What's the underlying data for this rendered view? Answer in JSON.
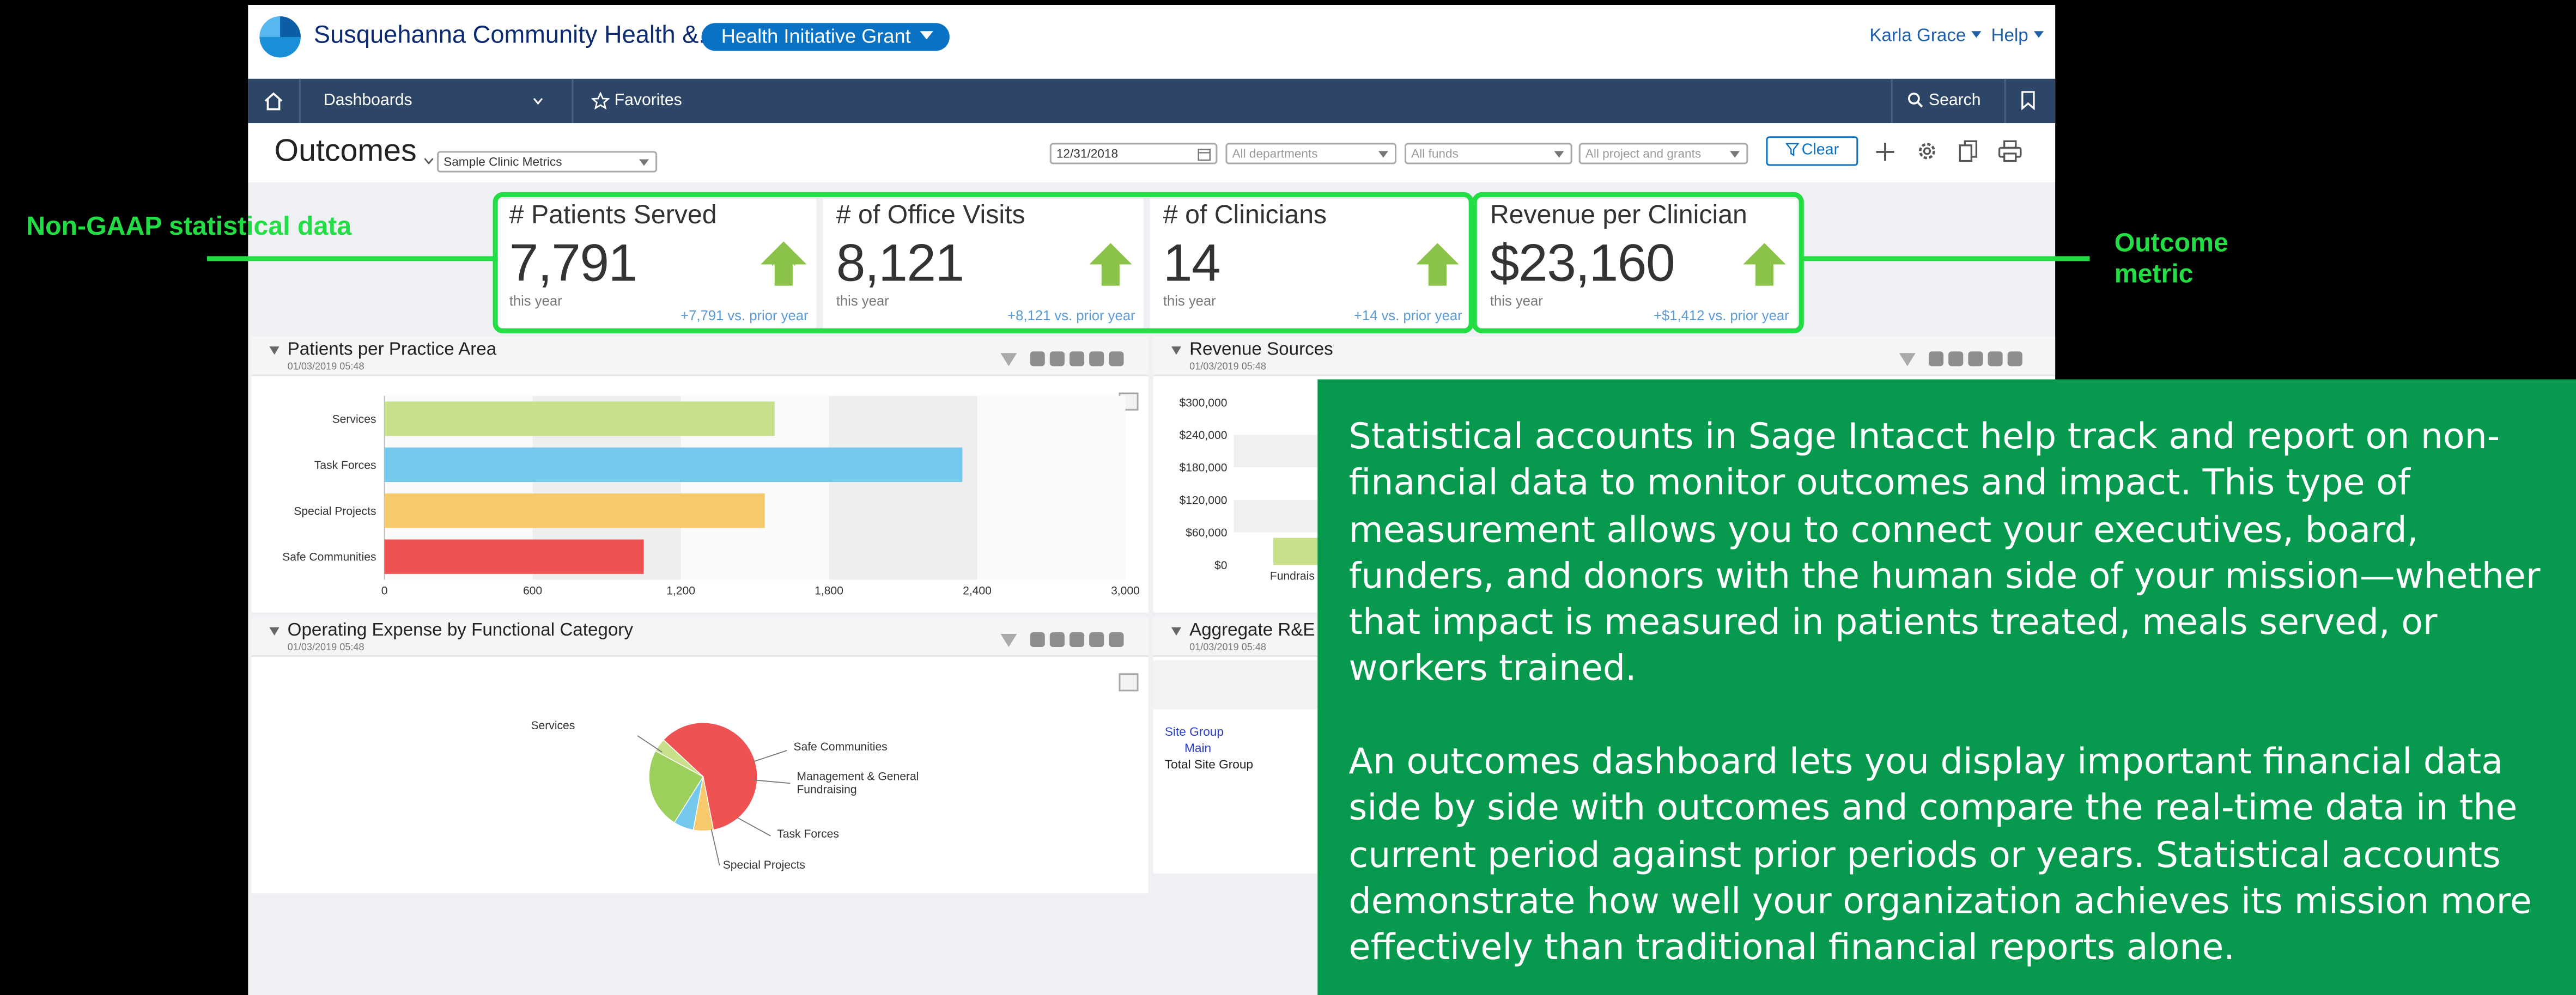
{
  "app": {
    "company": "Susquehanna Community Health &...",
    "grant_button": "Health Initiative Grant",
    "user": "Karla Grace",
    "help": "Help"
  },
  "navbar": {
    "dashboards": "Dashboards",
    "favorites": "Favorites",
    "search": "Search"
  },
  "titlebar": {
    "title": "Outcomes",
    "metrics_select": "Sample Clinic Metrics",
    "date": "12/31/2018",
    "departments_placeholder": "All departments",
    "funds_placeholder": "All funds",
    "projects_placeholder": "All project and grants",
    "clear_button": "Clear"
  },
  "kpis": [
    {
      "title": "# Patients Served",
      "value": "7,791",
      "period": "this year",
      "delta": "+7,791 vs. prior year"
    },
    {
      "title": "# of Office Visits",
      "value": "8,121",
      "period": "this year",
      "delta": "+8,121 vs. prior year"
    },
    {
      "title": "# of Clinicians",
      "value": "14",
      "period": "this year",
      "delta": "+14 vs. prior year"
    },
    {
      "title": "Revenue per Clinician",
      "value": "$23,160",
      "period": "this year",
      "delta": "+$1,412 vs. prior year"
    }
  ],
  "panels": {
    "practice": {
      "title": "Patients per Practice Area",
      "date": "01/03/2019 05:48"
    },
    "revenue": {
      "title": "Revenue Sources",
      "date": "01/03/2019 05:48"
    },
    "expense": {
      "title": "Operating Expense by Functional Category",
      "date": "01/03/2019 05:48"
    },
    "aggregate": {
      "title": "Aggregate R&E",
      "date": "01/03/2019 05:48"
    }
  },
  "aggregate_rows": [
    "Site Group",
    "Main",
    "Total Site Group"
  ],
  "chart_data": [
    {
      "type": "bar",
      "orientation": "horizontal",
      "categories": [
        "Services",
        "Task Forces",
        "Special Projects",
        "Safe Communities"
      ],
      "values": [
        1580,
        2340,
        1540,
        1050
      ],
      "colors": [
        "#c9e08a",
        "#74c8ec",
        "#f7c96d",
        "#ef5253"
      ],
      "xticks": [
        "0",
        "600",
        "1,200",
        "1,800",
        "2,400",
        "3,000"
      ],
      "xlim": [
        0,
        3000
      ]
    },
    {
      "type": "bar",
      "yticks": [
        "$300,000",
        "$240,000",
        "$180,000",
        "$120,000",
        "$60,000",
        "$0"
      ],
      "categories": [
        "Fundrais"
      ],
      "values": [
        50000
      ],
      "ylim": [
        0,
        300000
      ]
    },
    {
      "type": "pie",
      "labels": [
        "Services",
        "Safe Communities",
        "Management & General Fundraising",
        "Task Forces",
        "Special Projects"
      ],
      "values": [
        60,
        6,
        6,
        24,
        4
      ],
      "colors": [
        "#ef5253",
        "#f7c96d",
        "#74c8ec",
        "#9ccf5c",
        "#c9e08a"
      ]
    }
  ],
  "annotations": {
    "left": "Non-GAAP statistical data",
    "right": "Outcome metric"
  },
  "info": {
    "para1": "Statistical accounts in Sage Intacct help track and report on non-financial data to monitor outcomes and impact. This type of measurement allows you to connect your executives, board, funders, and donors with the human side of your mission—whether that impact is measured in patients treated, meals served, or workers trained.",
    "para2": "An outcomes dashboard lets you display important financial data side by side with outcomes and compare the real-time data in the current period against prior periods or years. Statistical accounts demonstrate how well your organization achieves its mission more effectively than traditional financial reports alone."
  }
}
